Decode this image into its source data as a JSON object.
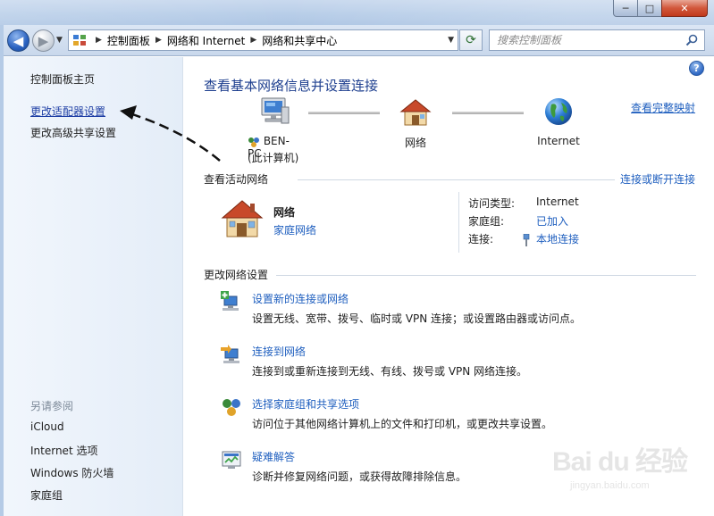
{
  "titlebar": {
    "minimize": "─",
    "maximize": "□",
    "close": "✕"
  },
  "address": {
    "breadcrumbs": [
      "控制面板",
      "网络和 Internet",
      "网络和共享中心"
    ]
  },
  "search": {
    "placeholder": "搜索控制面板"
  },
  "sidebar": {
    "home": "控制面板主页",
    "change_adapter": "更改适配器设置",
    "advanced_sharing": "更改高级共享设置",
    "see_also": "另请参阅",
    "see_also_items": [
      "iCloud",
      "Internet 选项",
      "Windows 防火墙",
      "家庭组"
    ]
  },
  "main": {
    "help": "?",
    "title": "查看基本网络信息并设置连接",
    "view_full_map": "查看完整映射",
    "map": {
      "computer_name": "BEN-PC",
      "computer_sub": "(此计算机)",
      "network": "网络",
      "internet": "Internet"
    },
    "active_networks": {
      "heading": "查看活动网络",
      "connect_link": "连接或断开连接",
      "network_name": "网络",
      "network_type": "家庭网络",
      "access_type_label": "访问类型:",
      "access_type_value": "Internet",
      "homegroup_label": "家庭组:",
      "homegroup_value": "已加入",
      "connections_label": "连接:",
      "connections_value": "本地连接"
    },
    "change_settings": {
      "heading": "更改网络设置",
      "tasks": [
        {
          "title": "设置新的连接或网络",
          "desc": "设置无线、宽带、拨号、临时或 VPN 连接；或设置路由器或访问点。"
        },
        {
          "title": "连接到网络",
          "desc": "连接到或重新连接到无线、有线、拨号或 VPN 网络连接。"
        },
        {
          "title": "选择家庭组和共享选项",
          "desc": "访问位于其他网络计算机上的文件和打印机，或更改共享设置。"
        },
        {
          "title": "疑难解答",
          "desc": "诊断并修复网络问题，或获得故障排除信息。"
        }
      ]
    }
  },
  "watermark": {
    "main": "Bai du 经验",
    "sub": "jingyan.baidu.com"
  }
}
